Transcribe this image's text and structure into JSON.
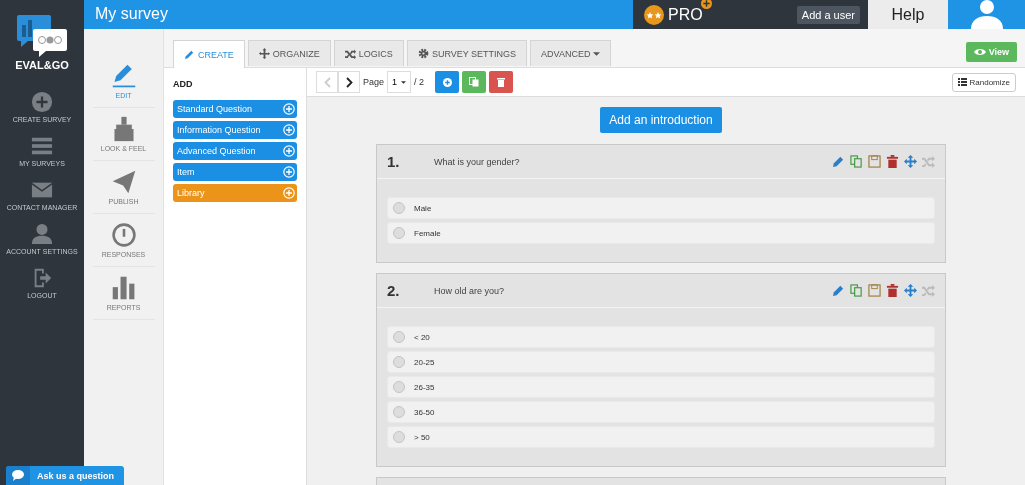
{
  "logo": {
    "text": "EVAL&GO"
  },
  "nav": [
    {
      "kind": "plus",
      "label": "CREATE SURVEY"
    },
    {
      "kind": "list",
      "label": "MY SURVEYS"
    },
    {
      "kind": "envelope",
      "label": "CONTACT MANAGER"
    },
    {
      "kind": "user",
      "label": "ACCOUNT SETTINGS"
    },
    {
      "kind": "logout",
      "label": "LOGOUT"
    }
  ],
  "header": {
    "title": "My survey",
    "plan": "PRO",
    "add_user": "Add a user",
    "help": "Help"
  },
  "tools": [
    {
      "kind": "pencil",
      "label": "EDIT",
      "selected": true
    },
    {
      "kind": "brush",
      "label": "LOOK & FEEL",
      "selected": false
    },
    {
      "kind": "plane",
      "label": "PUBLISH",
      "selected": false
    },
    {
      "kind": "gauge",
      "label": "RESPONSES",
      "selected": false
    },
    {
      "kind": "bars",
      "label": "REPORTS",
      "selected": false
    }
  ],
  "tabs": [
    {
      "kind": "pencil",
      "label": "CREATE",
      "selected": true
    },
    {
      "kind": "move",
      "label": "ORGANIZE",
      "selected": false
    },
    {
      "kind": "shuffle",
      "label": "LOGICS",
      "selected": false
    },
    {
      "kind": "gear",
      "label": "SURVEY SETTINGS",
      "selected": false
    },
    {
      "kind": "caret",
      "label": "ADVANCED",
      "selected": false
    }
  ],
  "view_button": "View",
  "add_panel": {
    "title": "ADD",
    "items": [
      {
        "label": "Standard Question",
        "color": "#1a8fe3"
      },
      {
        "label": "Information Question",
        "color": "#1a8fe3"
      },
      {
        "label": "Advanced Question",
        "color": "#1a8fe3"
      },
      {
        "label": "Item",
        "color": "#1a8fe3"
      },
      {
        "label": "Library",
        "color": "#ec9419"
      }
    ]
  },
  "pager": {
    "label": "Page",
    "page": "1",
    "total": "/ 2"
  },
  "randomize": "Randomize",
  "intro_button": "Add an introduction",
  "questions": [
    {
      "number": "1.",
      "text": "What is your gender?",
      "options": [
        {
          "label": "Male",
          "checked": false
        },
        {
          "label": "Female",
          "checked": false
        }
      ]
    },
    {
      "number": "2.",
      "text": "How old are you?",
      "options": [
        {
          "label": "< 20",
          "checked": false
        },
        {
          "label": "20-25",
          "checked": false
        },
        {
          "label": "26-35",
          "checked": false
        },
        {
          "label": "36-50",
          "checked": false
        },
        {
          "label": "> 50",
          "checked": false
        }
      ]
    }
  ],
  "chat_button": "Ask us a question"
}
